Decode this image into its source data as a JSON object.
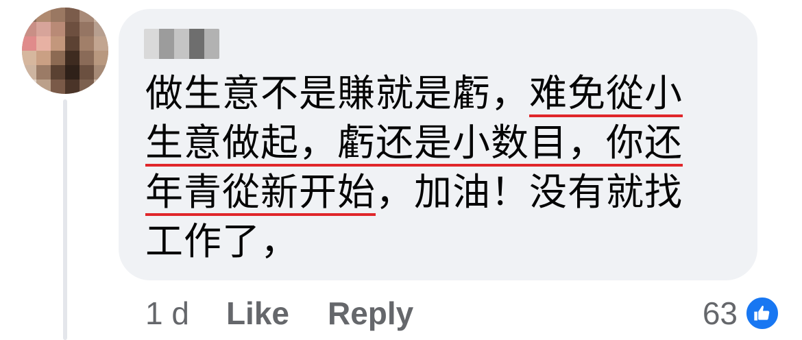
{
  "comment": {
    "lines": [
      {
        "plain": "做生意不是賺就是虧，",
        "highlight": "难免從小"
      },
      {
        "plain": "",
        "highlight": "生意做起，虧还是小数目，你还"
      },
      {
        "plain": "",
        "highlight": "年青從新开始",
        "after": "，加油！没有就找"
      },
      {
        "plain": "工作了，",
        "highlight": ""
      }
    ]
  },
  "actions": {
    "timestamp": "1 d",
    "like_label": "Like",
    "reply_label": "Reply"
  },
  "reactions": {
    "count": "63",
    "icon": "thumbs-up-icon",
    "color": "#1877f2"
  },
  "colors": {
    "bubble": "#f0f2f5",
    "highlight_underline": "#e0262a",
    "meta_text": "#65676b"
  }
}
